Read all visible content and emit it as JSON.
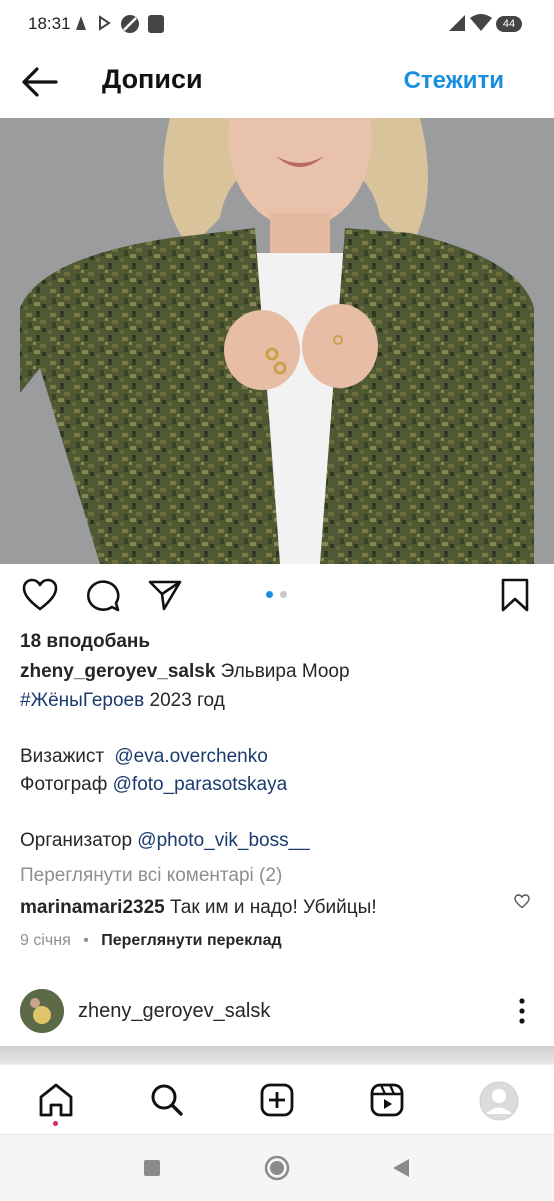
{
  "status_bar": {
    "time": "18:31",
    "battery": "44"
  },
  "header": {
    "title": "Дописи",
    "follow_label": "Стежити"
  },
  "post": {
    "carousel": {
      "count": 2,
      "active": 1
    },
    "likes": "18 вподобань",
    "caption": {
      "username": "zheny_geroyev_salsk",
      "line1_text": " Эльвира Моор",
      "hashtag": "#ЖёныГероев",
      "line2_text": " 2023 год",
      "makeup_label": "Визажист ",
      "makeup_mention": "@eva.overchenko",
      "photo_label": "Фотограф ",
      "photo_mention": "@foto_parasotskaya",
      "organizer_label": "Организатор ",
      "organizer_mention": "@photo_vik_boss__"
    },
    "view_comments": "Переглянути всі коментарі (2)",
    "comment": {
      "username": "marinamari2325",
      "text": " Так им и надо! Убийцы!"
    },
    "date": "9 січня",
    "separator": "•",
    "translate_label": "Переглянути переклад"
  },
  "next_post": {
    "username": "zheny_geroyev_salsk"
  },
  "bottom_nav": {
    "items": [
      {
        "name": "home",
        "active": true
      },
      {
        "name": "search"
      },
      {
        "name": "create"
      },
      {
        "name": "reels"
      },
      {
        "name": "profile"
      }
    ]
  },
  "colors": {
    "accent": "#1a8fe0",
    "mention": "#1b3a6e",
    "muted": "#8e8e8e",
    "notification": "#e0245e"
  }
}
